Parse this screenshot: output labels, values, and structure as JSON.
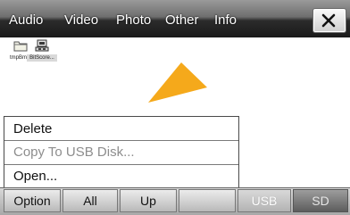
{
  "tabs": [
    {
      "label": "Audio",
      "state": "normal"
    },
    {
      "label": "Video",
      "state": "normal"
    },
    {
      "label": "Photo",
      "state": "normal"
    },
    {
      "label": "Other",
      "state": "active"
    },
    {
      "label": "Info",
      "state": "normal"
    }
  ],
  "close_icon": "close-icon",
  "files": [
    {
      "label": "tmpBm...",
      "icon": "folder-icon",
      "selected": false
    },
    {
      "label": "BitScore...",
      "icon": "program-icon",
      "selected": true
    }
  ],
  "context_menu": {
    "items": [
      {
        "label": "Delete",
        "enabled": true
      },
      {
        "label": "Copy To USB Disk...",
        "enabled": false
      },
      {
        "label": "Open...",
        "enabled": true
      }
    ]
  },
  "bottom_buttons": [
    {
      "label": "Option",
      "state": "normal"
    },
    {
      "label": "All",
      "state": "normal"
    },
    {
      "label": "Up",
      "state": "normal"
    },
    {
      "label": "",
      "state": "normal"
    },
    {
      "label": "USB",
      "state": "disabled"
    },
    {
      "label": "SD",
      "state": "selected"
    }
  ],
  "colors": {
    "arrow": "#f5a91b",
    "topbar": "#1a1a1a",
    "menu_border": "#4a4a4a"
  }
}
